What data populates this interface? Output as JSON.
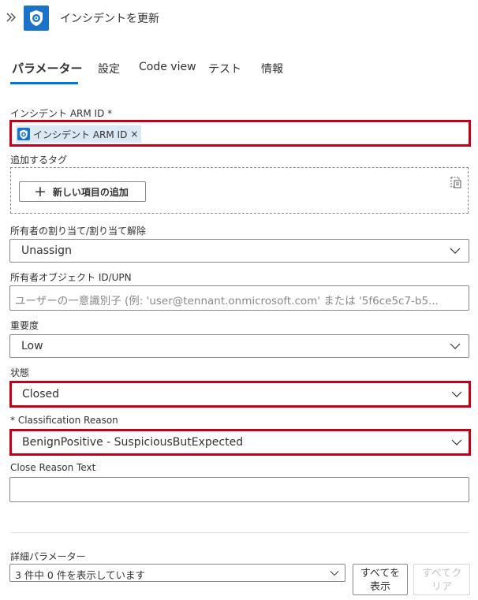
{
  "header": {
    "title": "インシデントを更新"
  },
  "tabs": [
    {
      "label": "パラメーター"
    },
    {
      "label": "設定"
    },
    {
      "label": "Code view"
    },
    {
      "label": "テスト"
    },
    {
      "label": "情報"
    }
  ],
  "fields": {
    "incident_arm_id": {
      "label": "インシデント ARM ID *",
      "chip_label": "インシデント ARM ID",
      "chip_remove": "×"
    },
    "tags": {
      "label": "追加するタグ",
      "add_button": "新しい項目の追加"
    },
    "owner_assign": {
      "label": "所有者の割り当て/割り当て解除",
      "value": "Unassign"
    },
    "owner_object_id": {
      "label": "所有者オブジェクト ID/UPN",
      "placeholder": "ユーザーの一意識別子 (例: 'user@tennant.onmicrosoft.com' または '5f6ce5c7-b5..."
    },
    "severity": {
      "label": "重要度",
      "value": "Low"
    },
    "status": {
      "label": "状態",
      "value": "Closed"
    },
    "classification_reason": {
      "label": "* Classification Reason",
      "value": "BenignPositive - SuspiciousButExpected"
    },
    "close_reason_text": {
      "label": "Close Reason Text",
      "value": ""
    }
  },
  "advanced": {
    "label": "詳細パラメーター",
    "dropdown_value": "3 件中 0 件を表示しています",
    "show_all_line1": "すべてを",
    "show_all_line2": "表示",
    "clear_all_line1": "すべてク",
    "clear_all_line2": "リア"
  },
  "colors": {
    "accent": "#0078d4",
    "highlight": "#c3001a",
    "app_icon": "#1a73c7",
    "chip_bg": "#dbe8f6"
  },
  "icons": {
    "expand": "double-chevron-right-icon",
    "app": "sentinel-shield-icon",
    "chevron": "chevron-down-icon",
    "dynamic_content": "dynamic-content-icon"
  }
}
